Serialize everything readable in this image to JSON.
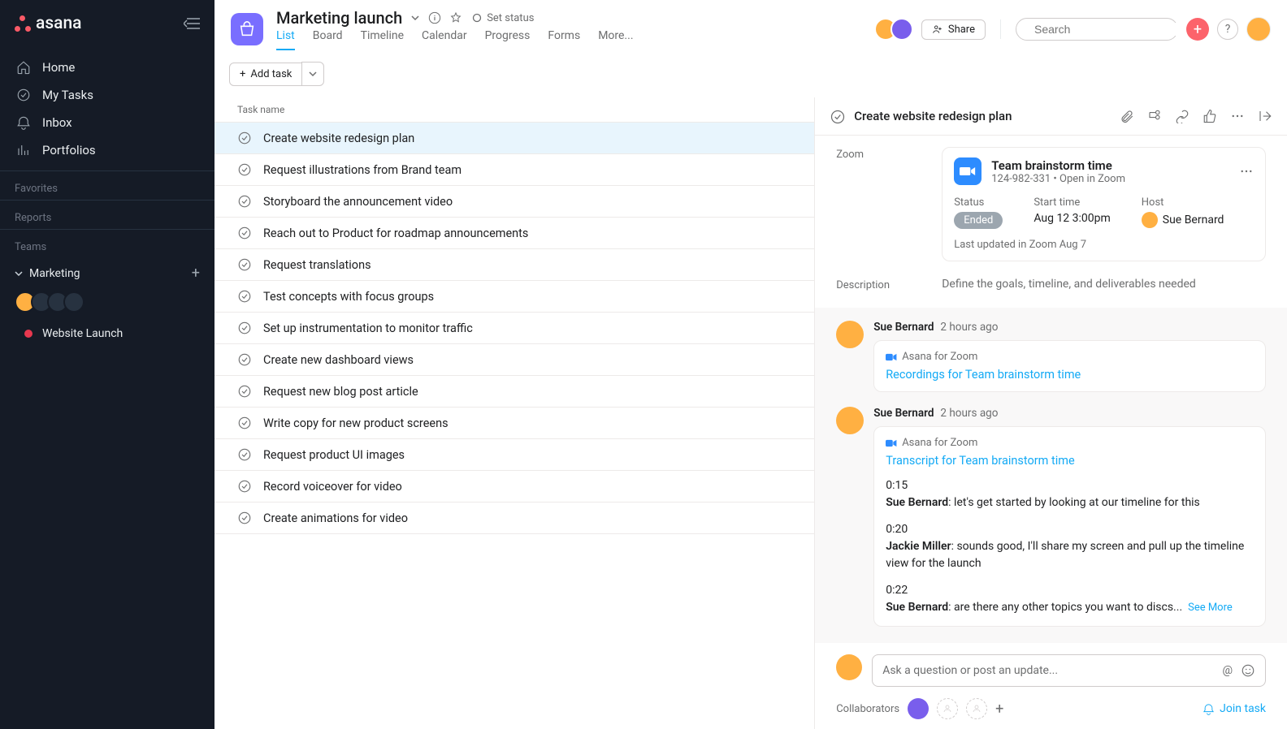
{
  "brand": "asana",
  "sidebar": {
    "nav": [
      {
        "label": "Home"
      },
      {
        "label": "My Tasks"
      },
      {
        "label": "Inbox"
      },
      {
        "label": "Portfolios"
      }
    ],
    "favorites_heading": "Favorites",
    "reports_heading": "Reports",
    "teams_heading": "Teams",
    "team_name": "Marketing",
    "project_name": "Website Launch"
  },
  "header": {
    "project_title": "Marketing launch",
    "set_status": "Set status",
    "tabs": [
      "List",
      "Board",
      "Timeline",
      "Calendar",
      "Progress",
      "Forms",
      "More..."
    ],
    "active_tab": "List",
    "share": "Share",
    "search_placeholder": "Search",
    "help": "?",
    "add_task": "Add task"
  },
  "list": {
    "column": "Task name",
    "tasks": [
      "Create website redesign plan",
      "Request illustrations from Brand team",
      "Storyboard the announcement video",
      "Reach out to Product for roadmap announcements",
      "Request translations",
      "Test concepts with focus groups",
      "Set up instrumentation to monitor traffic",
      "Create new dashboard views",
      "Request new blog post article",
      "Write copy for new product screens",
      "Request product UI images",
      "Record voiceover for video",
      "Create animations for video"
    ],
    "selected_index": 0
  },
  "detail": {
    "title": "Create website redesign plan",
    "zoom_label": "Zoom",
    "zoom_card": {
      "title": "Team brainstorm time",
      "id": "124-982-331",
      "open": "Open in Zoom",
      "status_label": "Status",
      "status_value": "Ended",
      "start_label": "Start time",
      "start_value": "Aug 12 3:00pm",
      "host_label": "Host",
      "host_value": "Sue Bernard",
      "updated": "Last updated in Zoom Aug 7"
    },
    "description_label": "Description",
    "description_text": "Define the goals, timeline, and deliverables needed",
    "source_app": "Asana for Zoom",
    "comments": [
      {
        "author": "Sue Bernard",
        "time": "2 hours ago",
        "link_text": "Recordings for Team brainstorm time"
      },
      {
        "author": "Sue Bernard",
        "time": "2 hours ago",
        "link_text": "Transcript for Team brainstorm time",
        "transcript": [
          {
            "ts": "0:15",
            "speaker": "Sue Bernard",
            "text": ": let's get started by looking at our timeline for this"
          },
          {
            "ts": "0:20",
            "speaker": "Jackie Miller",
            "text": ": sounds good, I'll share my screen and pull up the timeline view for the launch"
          },
          {
            "ts": "0:22",
            "speaker": "Sue Bernard",
            "text": ": are there any other topics you want to discs..."
          }
        ],
        "see_more": "See More"
      }
    ],
    "composer_placeholder": "Ask a question or post an update...",
    "collaborators_label": "Collaborators",
    "join": "Join task"
  }
}
